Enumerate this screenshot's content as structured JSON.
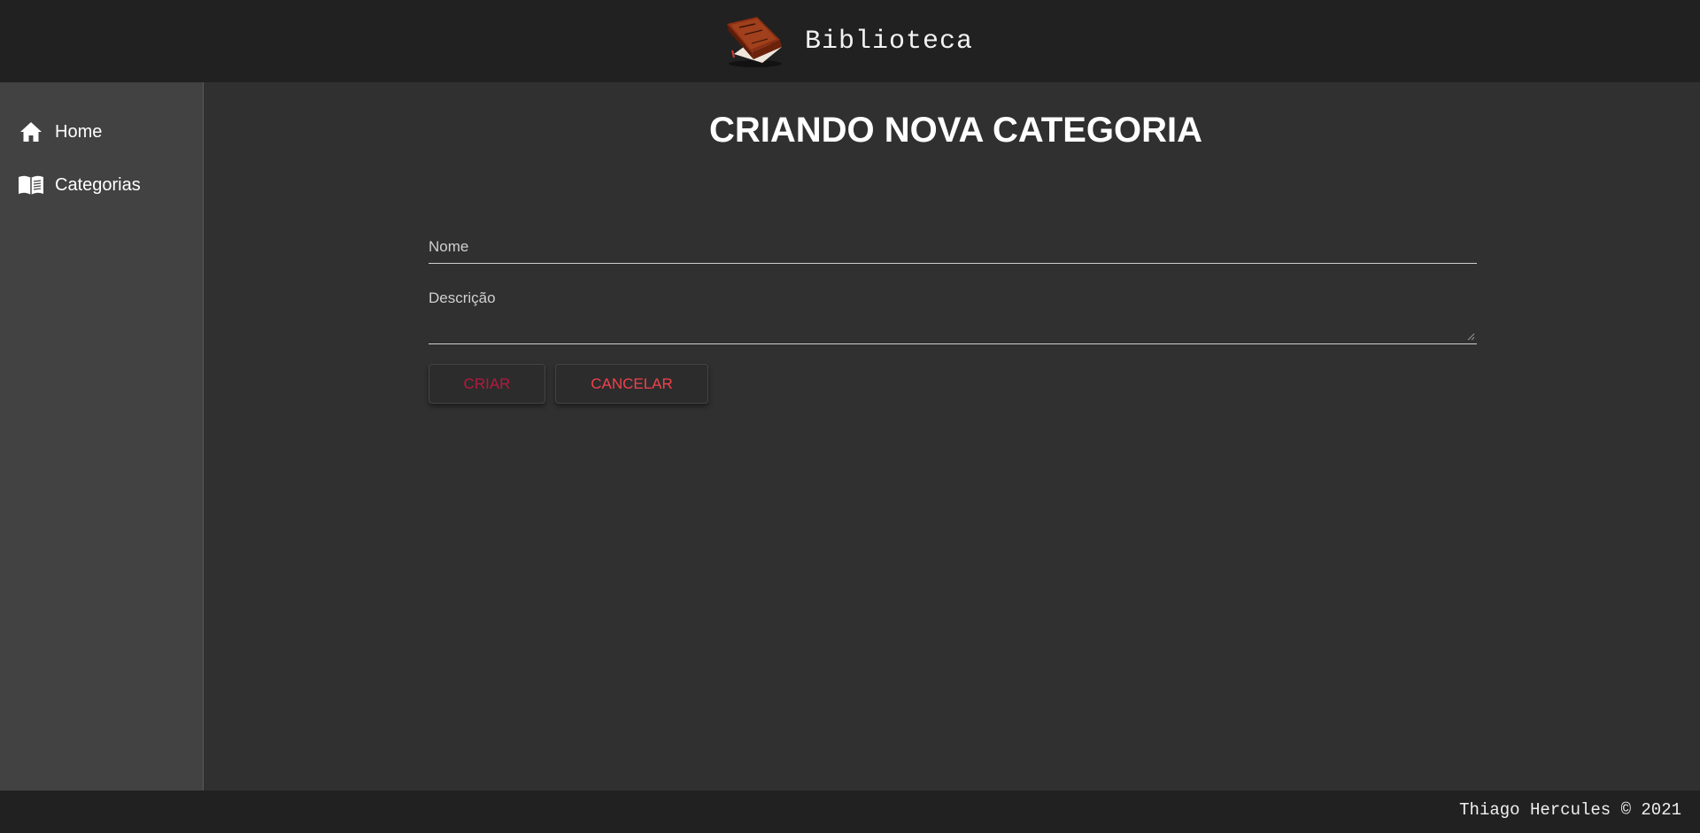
{
  "header": {
    "title": "Biblioteca",
    "logo_icon": "book-icon"
  },
  "sidebar": {
    "items": [
      {
        "label": "Home",
        "icon": "home-icon"
      },
      {
        "label": "Categorias",
        "icon": "open-book-icon"
      }
    ]
  },
  "main": {
    "title": "CRIANDO NOVA CATEGORIA",
    "form": {
      "nome": {
        "label": "Nome",
        "value": ""
      },
      "descricao": {
        "label": "Descrição",
        "value": ""
      }
    },
    "buttons": {
      "criar": "CRIAR",
      "cancelar": "CANCELAR"
    }
  },
  "footer": {
    "text": "Thiago Hercules © 2021"
  },
  "colors": {
    "header_bg": "#212121",
    "sidebar_bg": "#424242",
    "main_bg": "#303030",
    "criar_text": "#b5193f",
    "cancelar_text": "#f2414c"
  }
}
